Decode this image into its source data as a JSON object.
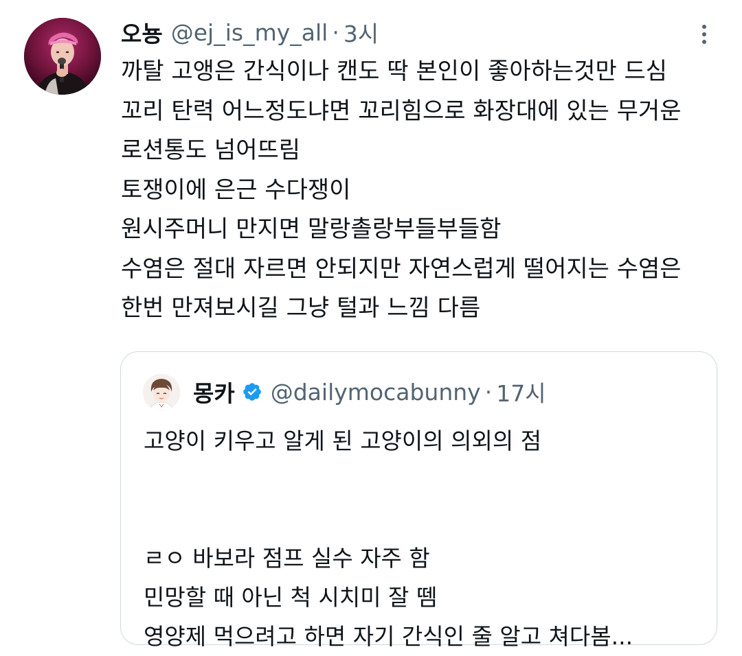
{
  "tweet": {
    "author": {
      "display_name": "오뇽",
      "handle": "@ej_is_my_all",
      "time": "3시"
    },
    "separator": "·",
    "lines": [
      "까탈 고앵은 간식이나 캔도 딱 본인이 좋아하는것만 드심",
      "꼬리 탄력 어느정도냐면 꼬리힘으로 화장대에 있는 무거운",
      "로션통도 넘어뜨림",
      "토쟁이에 은근 수다쟁이",
      "원시주머니 만지면 말랑촐랑부들부들함",
      "수염은 절대 자르면 안되지만 자연스럽게 떨어지는 수염은",
      "한번 만져보시길 그냥 털과 느낌 다름"
    ]
  },
  "quoted_tweet": {
    "author": {
      "display_name": "몽카",
      "handle": "@dailymocabunny",
      "time": "17시",
      "verified": true
    },
    "separator": "·",
    "first_line": "고양이 키우고 알게 된 고양이의 의외의 점",
    "lines": [
      "ㄹㅇ 바보라 점프 실수 자주 함",
      "민망할 때 아닌 척 시치미 잘 뗌",
      "영양제 먹으려고 하면 자기 간식인 줄 알고 쳐다봄..."
    ]
  },
  "colors": {
    "text_primary": "#0f1419",
    "text_secondary": "#536471",
    "border": "#cfd9de",
    "verified_blue": "#1d9bf0"
  },
  "icons": {
    "more": "more-options-icon",
    "verified": "verified-badge-icon"
  }
}
